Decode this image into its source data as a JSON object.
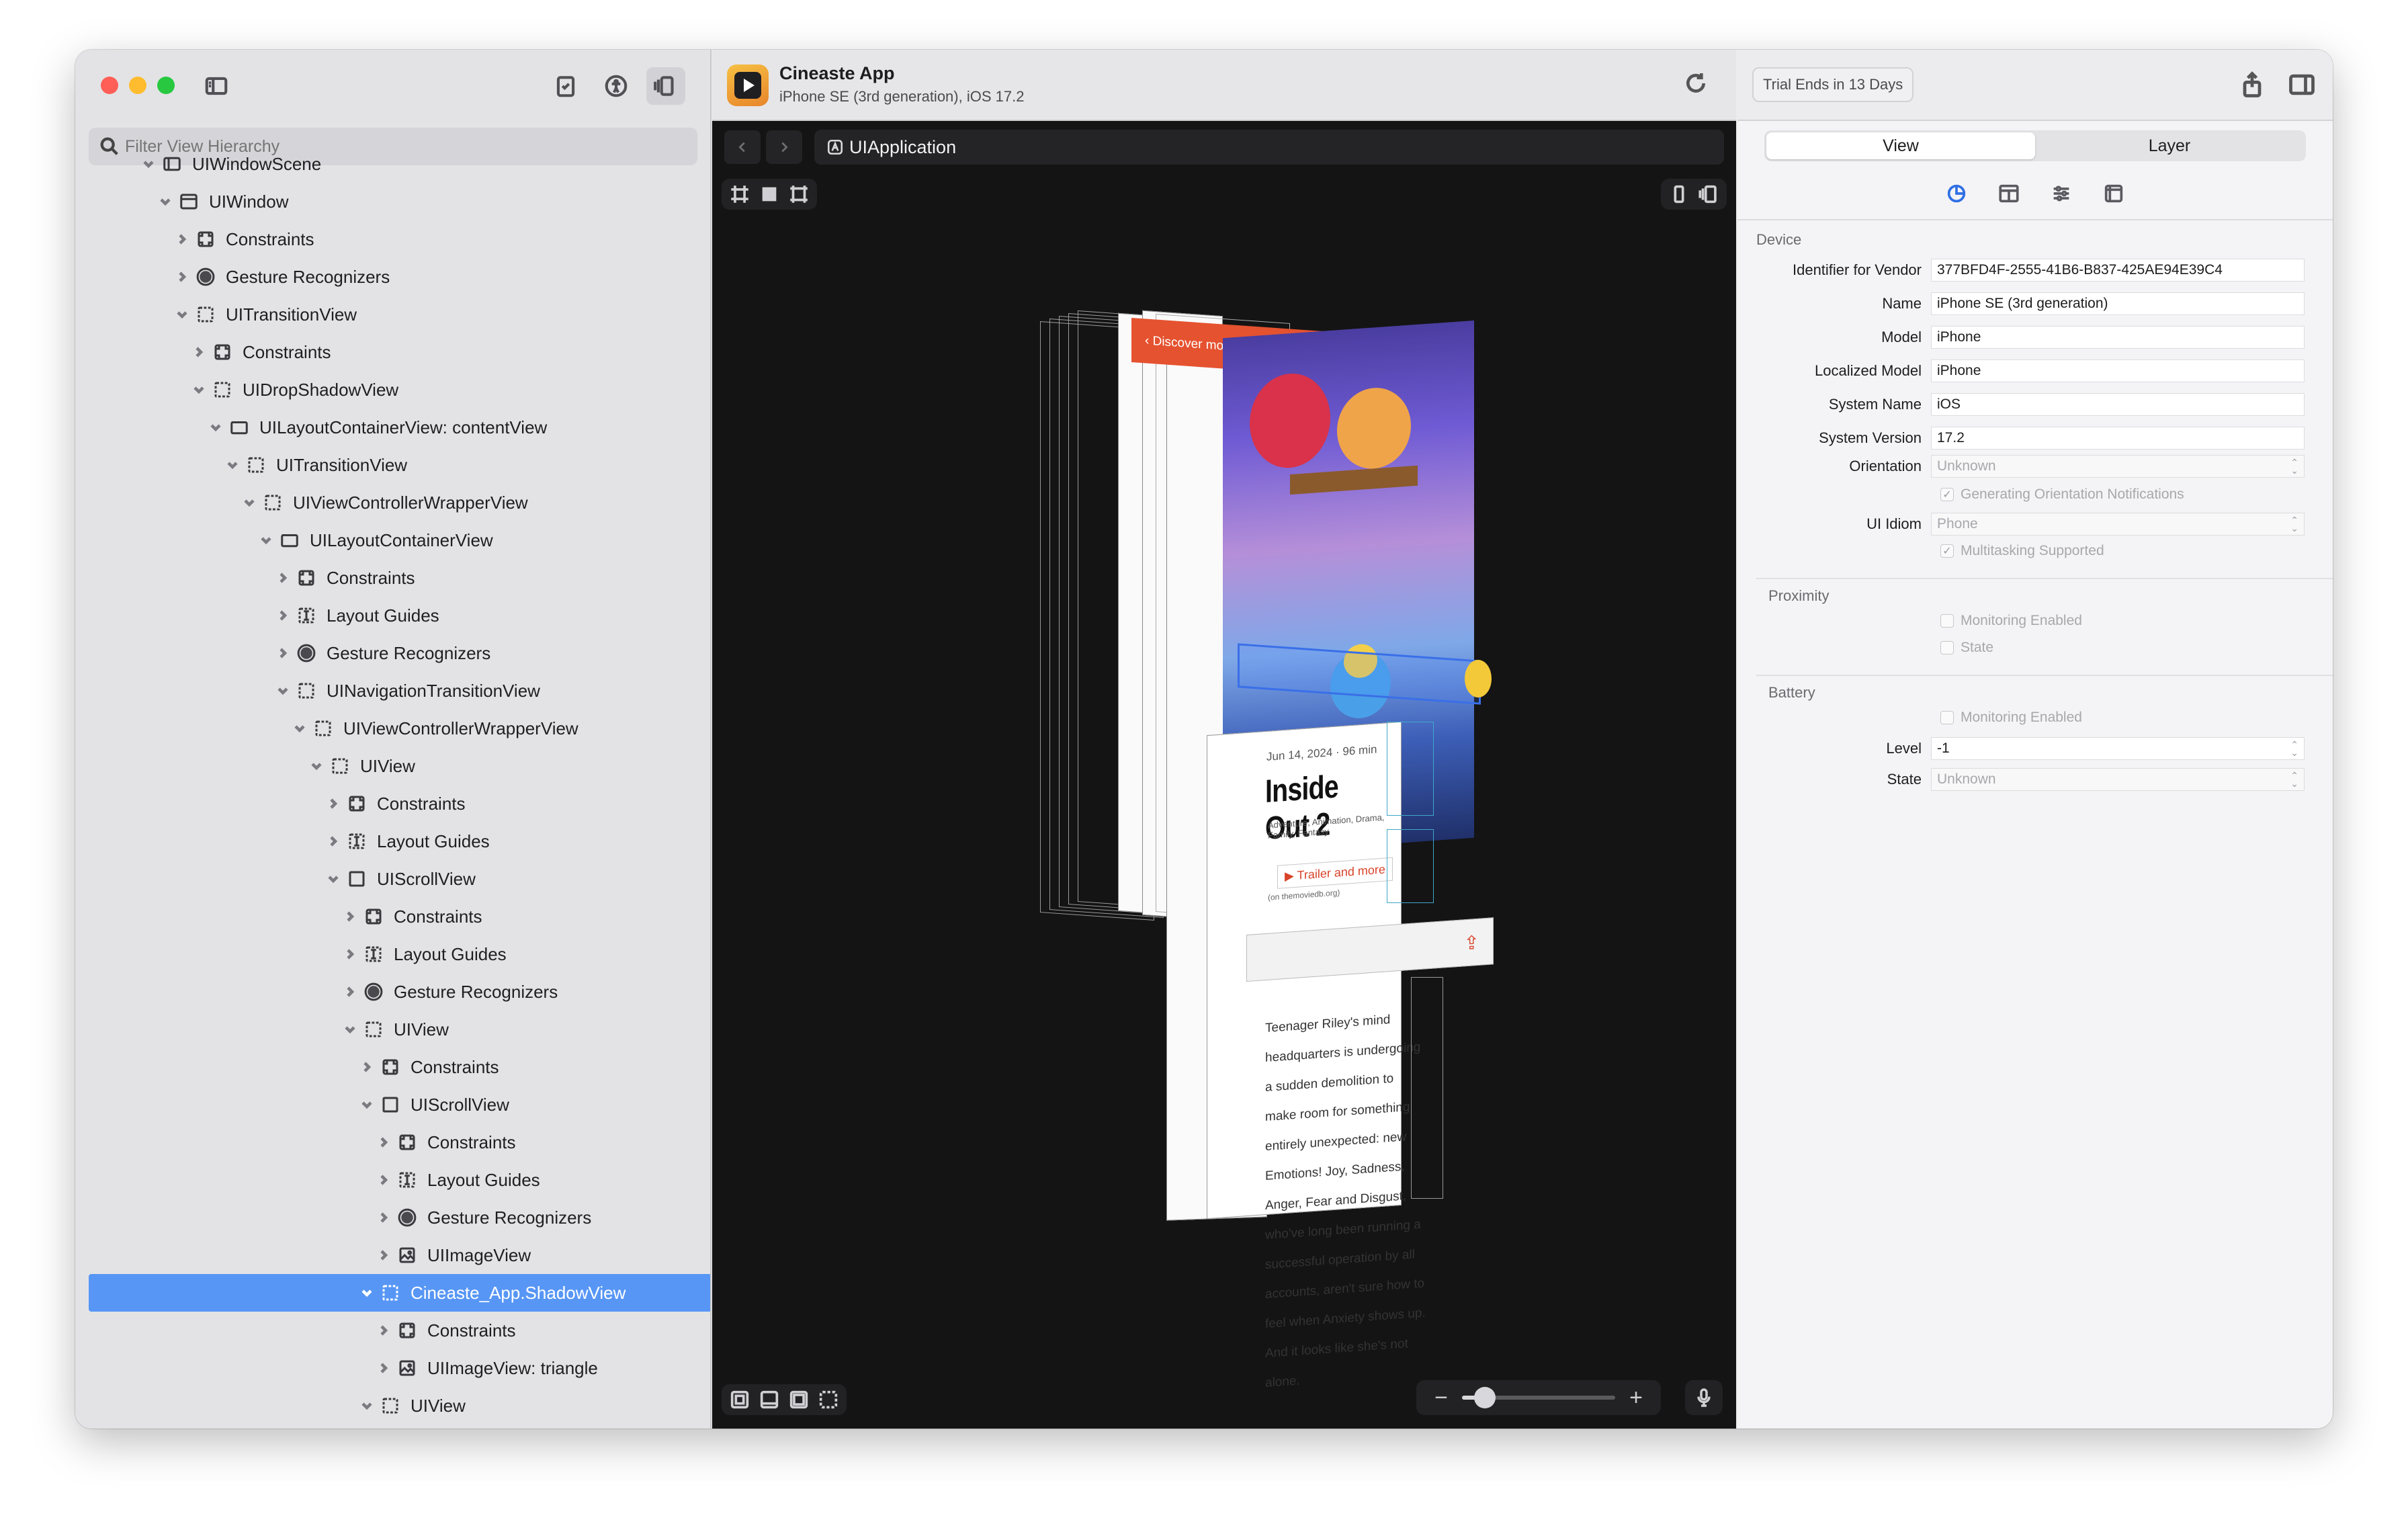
{
  "sidebar": {
    "filter_placeholder": "Filter View Hierarchy",
    "tree": [
      {
        "label": "UIWindowScene",
        "depth": 0,
        "icon": "window-scene",
        "open": true
      },
      {
        "label": "UIWindow",
        "depth": 1,
        "icon": "window",
        "open": true
      },
      {
        "label": "Constraints",
        "depth": 2,
        "icon": "constraints",
        "open": false
      },
      {
        "label": "Gesture Recognizers",
        "depth": 2,
        "icon": "gesture",
        "open": false
      },
      {
        "label": "UITransitionView",
        "depth": 2,
        "icon": "view",
        "open": true
      },
      {
        "label": "Constraints",
        "depth": 3,
        "icon": "constraints",
        "open": false
      },
      {
        "label": "UIDropShadowView",
        "depth": 3,
        "icon": "view",
        "open": true
      },
      {
        "label": "UILayoutContainerView: contentView",
        "depth": 4,
        "icon": "container",
        "open": true
      },
      {
        "label": "UITransitionView",
        "depth": 5,
        "icon": "view",
        "open": true
      },
      {
        "label": "UIViewControllerWrapperView",
        "depth": 6,
        "icon": "view",
        "open": true
      },
      {
        "label": "UILayoutContainerView",
        "depth": 7,
        "icon": "container",
        "open": true
      },
      {
        "label": "Constraints",
        "depth": 8,
        "icon": "constraints",
        "open": false
      },
      {
        "label": "Layout Guides",
        "depth": 8,
        "icon": "guides",
        "open": false
      },
      {
        "label": "Gesture Recognizers",
        "depth": 8,
        "icon": "gesture",
        "open": false
      },
      {
        "label": "UINavigationTransitionView",
        "depth": 8,
        "icon": "view",
        "open": true
      },
      {
        "label": "UIViewControllerWrapperView",
        "depth": 9,
        "icon": "view",
        "open": true
      },
      {
        "label": "UIView",
        "depth": 10,
        "icon": "view",
        "open": true
      },
      {
        "label": "Constraints",
        "depth": 11,
        "icon": "constraints",
        "open": false
      },
      {
        "label": "Layout Guides",
        "depth": 11,
        "icon": "guides",
        "open": false
      },
      {
        "label": "UIScrollView",
        "depth": 11,
        "icon": "scroll",
        "open": true
      },
      {
        "label": "Constraints",
        "depth": 12,
        "icon": "constraints",
        "open": false
      },
      {
        "label": "Layout Guides",
        "depth": 12,
        "icon": "guides",
        "open": false
      },
      {
        "label": "Gesture Recognizers",
        "depth": 12,
        "icon": "gesture",
        "open": false
      },
      {
        "label": "UIView",
        "depth": 12,
        "icon": "view",
        "open": true
      },
      {
        "label": "Constraints",
        "depth": 13,
        "icon": "constraints",
        "open": false
      },
      {
        "label": "UIScrollView",
        "depth": 13,
        "icon": "scroll",
        "open": true
      },
      {
        "label": "Constraints",
        "depth": 14,
        "icon": "constraints",
        "open": false
      },
      {
        "label": "Layout Guides",
        "depth": 14,
        "icon": "guides",
        "open": false
      },
      {
        "label": "Gesture Recognizers",
        "depth": 14,
        "icon": "gesture",
        "open": false
      },
      {
        "label": "UIImageView",
        "depth": 14,
        "icon": "image",
        "open": false
      },
      {
        "label": "Cineaste_App.ShadowView",
        "depth": 13,
        "icon": "view",
        "open": true,
        "selected": true
      },
      {
        "label": "Constraints",
        "depth": 14,
        "icon": "constraints",
        "open": false
      },
      {
        "label": "UIImageView: triangle",
        "depth": 14,
        "icon": "image",
        "open": false
      },
      {
        "label": "UIView",
        "depth": 13,
        "icon": "view",
        "open": true
      }
    ]
  },
  "center": {
    "app_name": "Cineaste App",
    "device": "iPhone SE (3rd generation), iOS 17.2",
    "breadcrumb": "UIApplication",
    "zoom_level": 0.15,
    "preview": {
      "nav_title": "Discover movies",
      "date": "Jun 14, 2024 · 96 min",
      "movie_title": "Inside Out 2",
      "genres": "Adventure, Animation, Drama, Family, Fantasy",
      "trailer": "▶ Trailer and more",
      "source": "(on themoviedb.org)",
      "overview": "Teenager Riley's mind headquarters is undergoing a sudden demolition to make room for something entirely unexpected: new Emotions! Joy, Sadness, Anger, Fear and Disgust, who've long been running a successful operation by all accounts, aren't sure how to feel when Anxiety shows up. And it looks like she's not alone."
    }
  },
  "inspector": {
    "trial": "Trial Ends in 13 Days",
    "tabs": {
      "view": "View",
      "layer": "Layer"
    },
    "device_section": "Device",
    "props": [
      {
        "label": "Identifier for Vendor",
        "value": "377BFD4F-2555-41B6-B837-425AE94E39C4"
      },
      {
        "label": "Name",
        "value": "iPhone SE (3rd generation)"
      },
      {
        "label": "Model",
        "value": "iPhone"
      },
      {
        "label": "Localized Model",
        "value": "iPhone"
      },
      {
        "label": "System Name",
        "value": "iOS"
      },
      {
        "label": "System Version",
        "value": "17.2"
      }
    ],
    "orientation": {
      "label": "Orientation",
      "value": "Unknown"
    },
    "gen_notifications": "Generating Orientation Notifications",
    "ui_idiom": {
      "label": "UI Idiom",
      "value": "Phone"
    },
    "multitasking": "Multitasking Supported",
    "proximity_section": "Proximity",
    "prox_monitoring": "Monitoring Enabled",
    "prox_state": "State",
    "battery_section": "Battery",
    "bat_monitoring": "Monitoring Enabled",
    "bat_level": {
      "label": "Level",
      "value": "-1"
    },
    "bat_state": {
      "label": "State",
      "value": "Unknown"
    }
  }
}
